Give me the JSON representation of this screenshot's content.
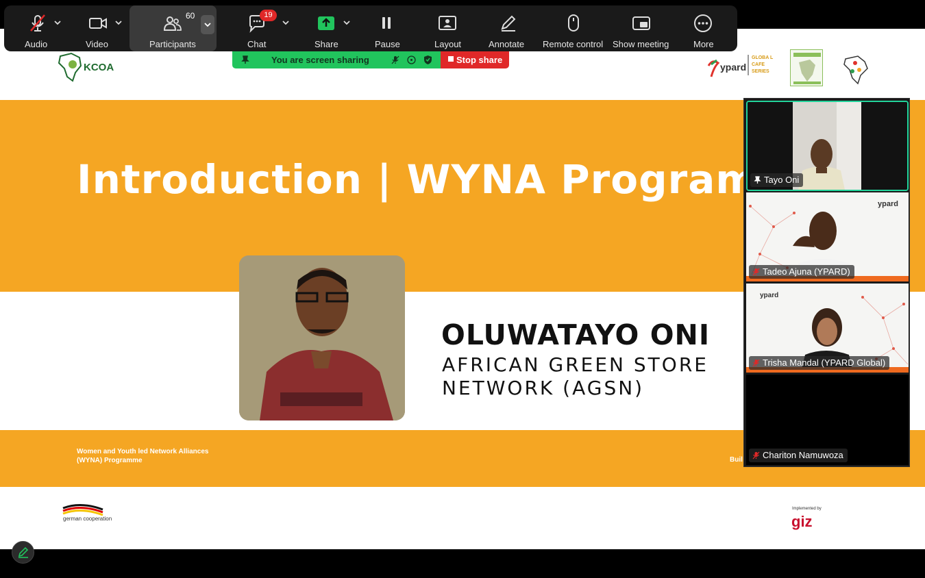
{
  "toolbar": {
    "audio_label": "Audio",
    "video_label": "Video",
    "participants_label": "Participants",
    "participants_count": "60",
    "chat_label": "Chat",
    "chat_badge": "19",
    "share_label": "Share",
    "pause_label": "Pause",
    "layout_label": "Layout",
    "annotate_label": "Annotate",
    "remote_label": "Remote control",
    "show_meeting_label": "Show meeting",
    "more_label": "More"
  },
  "share_bar": {
    "status": "You are screen sharing",
    "stop_label": "Stop share"
  },
  "slide": {
    "title": "Introduction | WYNA Programm",
    "speaker_name": "OLUWATAYO ONI",
    "org_line_1": "AFRICAN GREEN STORE",
    "org_line_2": "NETWORK (AGSN)",
    "footer_programme": "Women and Youth led Network Alliances (WYNA) Programme",
    "footer_right": "Buil",
    "kcoa": "KCOA",
    "ypard": "ypard",
    "cafe_series": "GLOBA L CAFE SERIES",
    "german_coop": "german cooperation",
    "giz": "giz",
    "giz_implemented": "Implemented by"
  },
  "participants": [
    {
      "name": "Tayo Oni",
      "muted": false
    },
    {
      "name": "Tadeo Ajuna (YPARD)",
      "muted": true
    },
    {
      "name": "Trisha Mandal (YPARD Global)",
      "muted": true
    },
    {
      "name": "Chariton Namuwoza",
      "muted": true
    }
  ],
  "colors": {
    "slide_orange": "#F5A623",
    "share_green": "#21c45d",
    "stop_red": "#e02828",
    "active_speaker": "#22d39a"
  }
}
